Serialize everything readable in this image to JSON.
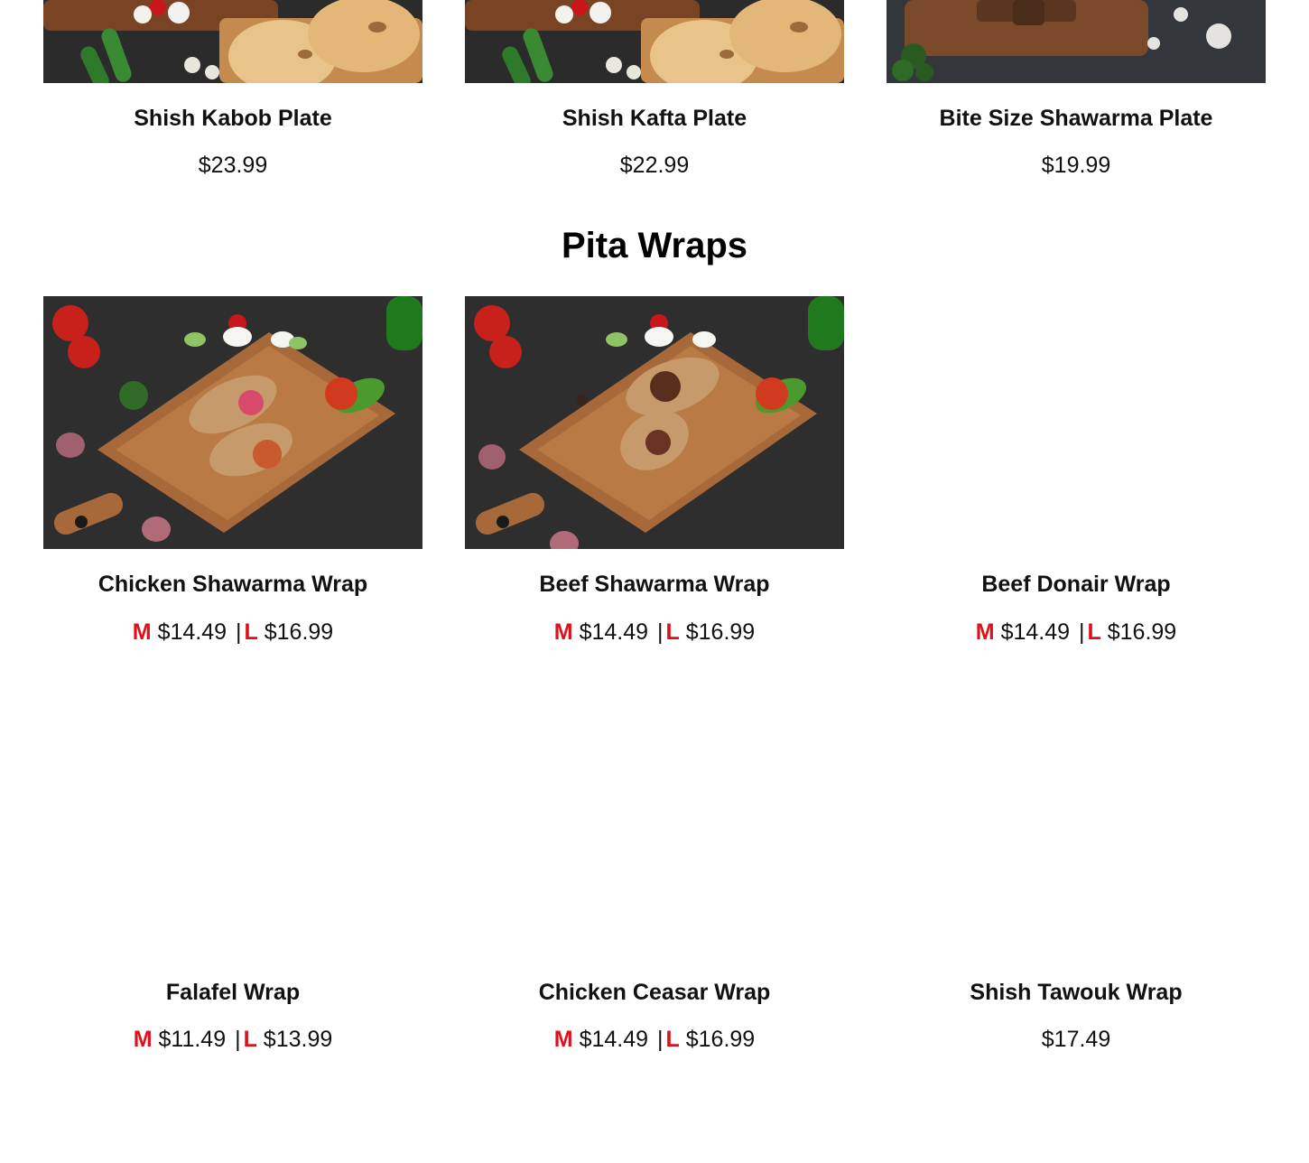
{
  "plates": [
    {
      "name": "Shish Kabob Plate",
      "price": "$23.99"
    },
    {
      "name": "Shish Kafta Plate",
      "price": "$22.99"
    },
    {
      "name": "Bite Size Shawarma Plate",
      "price": "$19.99"
    }
  ],
  "section": {
    "title": "Pita Wraps"
  },
  "wraps": [
    {
      "name": "Chicken Shawarma Wrap",
      "m_label": "M",
      "m_price": "$14.49",
      "sep": "|",
      "l_label": "L",
      "l_price": "$16.99"
    },
    {
      "name": "Beef Shawarma Wrap",
      "m_label": "M",
      "m_price": "$14.49",
      "sep": "|",
      "l_label": "L",
      "l_price": "$16.99"
    },
    {
      "name": "Beef Donair Wrap",
      "m_label": "M",
      "m_price": "$14.49",
      "sep": "|",
      "l_label": "L",
      "l_price": "$16.99"
    },
    {
      "name": "Falafel Wrap",
      "m_label": "M",
      "m_price": "$11.49",
      "sep": "|",
      "l_label": "L",
      "l_price": "$13.99"
    },
    {
      "name": "Chicken Ceasar Wrap",
      "m_label": "M",
      "m_price": "$14.49",
      "sep": "|",
      "l_label": "L",
      "l_price": "$16.99"
    },
    {
      "name": "Shish Tawouk Wrap",
      "price": "$17.49"
    }
  ],
  "colors": {
    "size_label": "#e0101b",
    "text": "#111111"
  }
}
